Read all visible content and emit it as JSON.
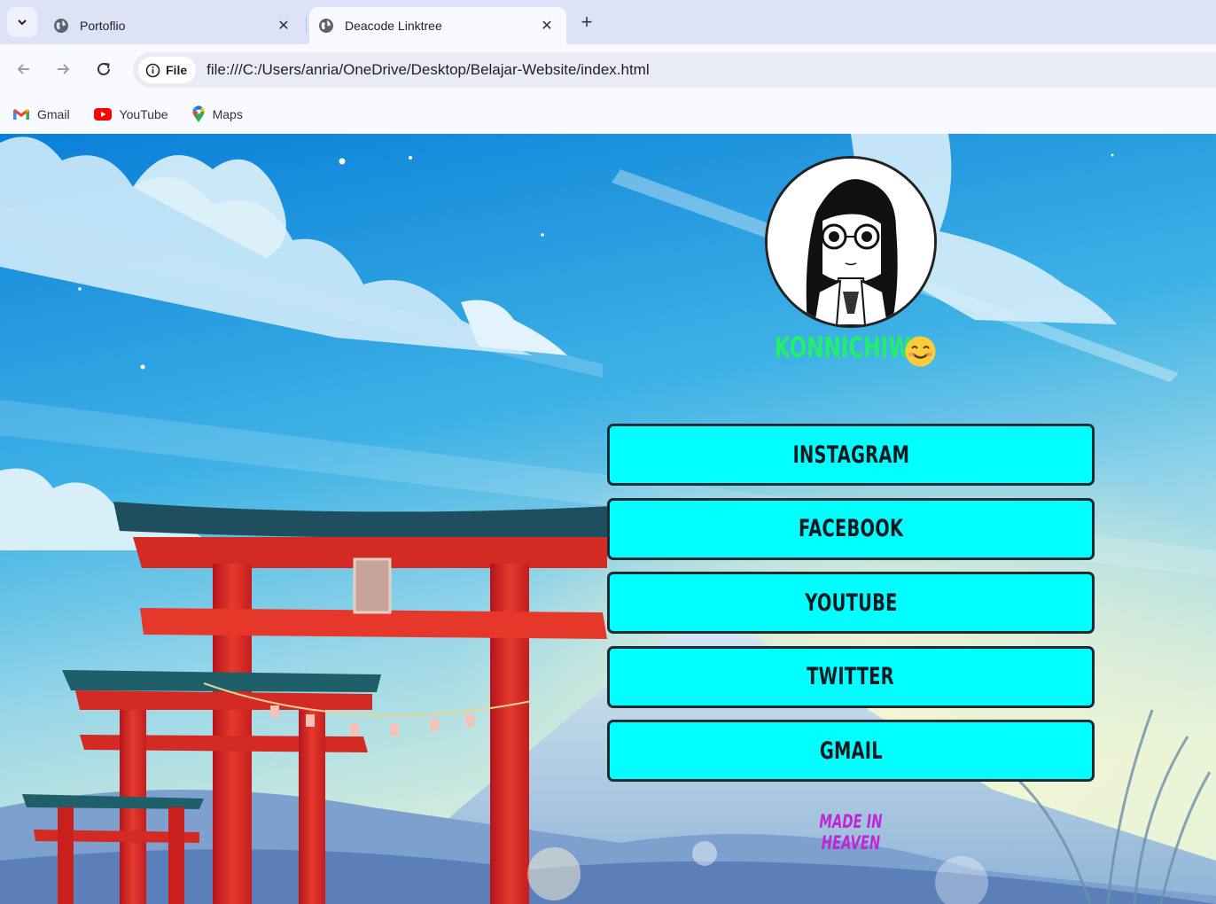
{
  "browser": {
    "tabs": [
      {
        "title": "Portoflio",
        "active": false
      },
      {
        "title": "Deacode Linktree",
        "active": true
      }
    ],
    "address_chip": "File",
    "url": "file:///C:/Users/anria/OneDrive/Desktop/Belajar-Website/index.html",
    "bookmarks": [
      {
        "label": "Gmail",
        "icon": "gmail-icon"
      },
      {
        "label": "YouTube",
        "icon": "youtube-icon"
      },
      {
        "label": "Maps",
        "icon": "maps-icon"
      }
    ]
  },
  "page": {
    "greeting": "KONNICHIWA",
    "greeting_emoji": "smiling-face-icon",
    "links": [
      {
        "label": "INSTAGRAM"
      },
      {
        "label": "FACEBOOK"
      },
      {
        "label": "YOUTUBE"
      },
      {
        "label": "TWITTER"
      },
      {
        "label": "GMAIL"
      }
    ],
    "footer": "MADE IN HEAVEN"
  },
  "colors": {
    "button_bg": "#00ffff",
    "button_border": "#1c2a33",
    "greeting": "#22ef6a",
    "footer": "#c026d3",
    "tabstrip": "#dde3f7"
  }
}
